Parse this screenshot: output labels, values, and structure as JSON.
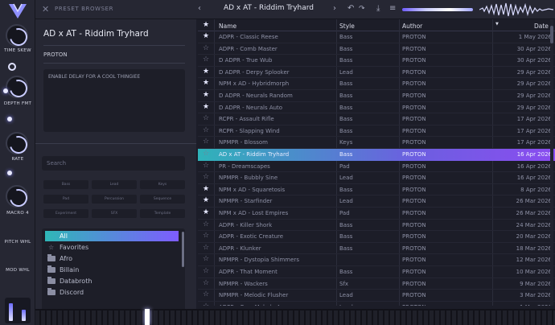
{
  "topbar": {
    "title": "PRESET BROWSER",
    "preset": "AD x AT - Riddim Tryhard"
  },
  "macros": [
    {
      "label": "TIME SKEW"
    },
    {
      "label": "DEPTH FMT"
    },
    {
      "label": "RATE"
    },
    {
      "label": "MACRO 4"
    },
    {
      "label": "PITCH WHL"
    },
    {
      "label": "MOD WHL"
    }
  ],
  "panel": {
    "preset_name": "AD x AT - Riddim Tryhard",
    "author": "PROTON",
    "description": "ENABLE DELAY FOR A COOL THINGIEE",
    "search_placeholder": "Search",
    "tags": [
      "Bass",
      "Lead",
      "Keys",
      "Pad",
      "Percussion",
      "Sequence",
      "Experiment",
      "SFX",
      "Template"
    ],
    "categories": [
      {
        "label": "All",
        "icon": "none"
      },
      {
        "label": "Favorites",
        "icon": "star-icon"
      },
      {
        "label": "Afro",
        "icon": "folder-icon"
      },
      {
        "label": "Billain",
        "icon": "folder-icon"
      },
      {
        "label": "Databroth",
        "icon": "folder-icon"
      },
      {
        "label": "Discord",
        "icon": "folder-icon"
      }
    ]
  },
  "table": {
    "headers": {
      "name": "Name",
      "style": "Style",
      "author": "Author",
      "date": "Date"
    },
    "rows": [
      {
        "fav": true,
        "name": "ADPR - Classic Reese",
        "style": "Bass",
        "author": "PROTON",
        "date": "1 May 2026"
      },
      {
        "fav": false,
        "name": "ADPR - Comb Master",
        "style": "Bass",
        "author": "PROTON",
        "date": "30 Apr 2026"
      },
      {
        "fav": false,
        "name": "D ADPR - True Wub",
        "style": "Bass",
        "author": "PROTON",
        "date": "30 Apr 2026"
      },
      {
        "fav": true,
        "name": "D ADPR - Derpy Splooker",
        "style": "Lead",
        "author": "PROTON",
        "date": "29 Apr 2026"
      },
      {
        "fav": true,
        "name": "NPM x AD - Hybridmorph",
        "style": "Bass",
        "author": "PROTON",
        "date": "29 Apr 2026"
      },
      {
        "fav": true,
        "name": "D ADPR - Neurals Random",
        "style": "Bass",
        "author": "PROTON",
        "date": "29 Apr 2026"
      },
      {
        "fav": true,
        "name": "D ADPR - Neurals Auto",
        "style": "Bass",
        "author": "PROTON",
        "date": "29 Apr 2026"
      },
      {
        "fav": false,
        "name": "RCPR - Assault Rifle",
        "style": "Bass",
        "author": "PROTON",
        "date": "17 Apr 2026"
      },
      {
        "fav": false,
        "name": "RCPR - Slapping Wind",
        "style": "Bass",
        "author": "PROTON",
        "date": "17 Apr 2026"
      },
      {
        "fav": false,
        "name": "NPMPR - Blossom",
        "style": "Keys",
        "author": "PROTON",
        "date": "17 Apr 2026"
      },
      {
        "fav": false,
        "name": "AD x AT - Riddim Tryhard",
        "style": "Bass",
        "author": "PROTON",
        "date": "16 Apr 2026",
        "selected": true
      },
      {
        "fav": false,
        "name": "PR - Dreamscapes",
        "style": "Pad",
        "author": "PROTON",
        "date": "16 Apr 2026"
      },
      {
        "fav": false,
        "name": "NPMPR - Bubbly Sine",
        "style": "Lead",
        "author": "PROTON",
        "date": "16 Apr 2026"
      },
      {
        "fav": true,
        "name": "NPM x AD - Squaretosis",
        "style": "Bass",
        "author": "PROTON",
        "date": "8 Apr 2026"
      },
      {
        "fav": true,
        "name": "NPMPR - Starfinder",
        "style": "Lead",
        "author": "PROTON",
        "date": "26 Mar 2026"
      },
      {
        "fav": true,
        "name": "NPM x AD - Lost Empires",
        "style": "Pad",
        "author": "PROTON",
        "date": "26 Mar 2026"
      },
      {
        "fav": false,
        "name": "ADPR - Killer Shork",
        "style": "Bass",
        "author": "PROTON",
        "date": "24 Mar 2026"
      },
      {
        "fav": false,
        "name": "ADPR - Exotic Creature",
        "style": "Bass",
        "author": "PROTON",
        "date": "20 Mar 2026"
      },
      {
        "fav": false,
        "name": "ADPR - Klunker",
        "style": "Bass",
        "author": "PROTON",
        "date": "18 Mar 2026"
      },
      {
        "fav": false,
        "name": "NPMPR - Dystopia Shimmers",
        "style": "",
        "author": "PROTON",
        "date": "12 Mar 2026"
      },
      {
        "fav": false,
        "name": "ADPR - That Moment",
        "style": "Bass",
        "author": "PROTON",
        "date": "10 Mar 2026"
      },
      {
        "fav": false,
        "name": "NPMPR - Wackers",
        "style": "Sfx",
        "author": "PROTON",
        "date": "9 Mar 2026"
      },
      {
        "fav": false,
        "name": "NPMPR - Melodic Flusher",
        "style": "Lead",
        "author": "PROTON",
        "date": "3 Mar 2026"
      },
      {
        "fav": false,
        "name": "ADPR - Core Melody A",
        "style": "Lead",
        "author": "PROTON",
        "date": "1 Mar 2026"
      }
    ]
  },
  "colors": {
    "accent_start": "#2fb7b7",
    "accent_end": "#7e5cff",
    "bg": "#1c1d28",
    "panel": "#262733"
  }
}
